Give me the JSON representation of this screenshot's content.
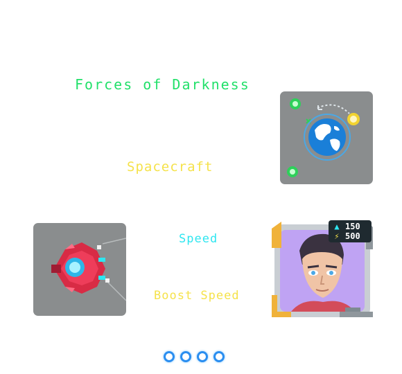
{
  "title": "Forces of Darkness",
  "subtitle": "Spacecraft",
  "stats_labels": {
    "speed": "Speed",
    "boost": "Boost Speed"
  },
  "pilot_stats": {
    "stat1_value": "150",
    "stat2_value": "500"
  },
  "icons": {
    "planet": "planet-orbit-icon",
    "ship": "spaceship-icon",
    "pilot": "pilot-portrait",
    "stat1": "level-up-icon",
    "stat2": "lightning-icon"
  },
  "pager": {
    "count": 4
  },
  "colors": {
    "title": "#22e06a",
    "subtitle": "#f5e24a",
    "speed": "#2ee6f0",
    "boost": "#f5e24a",
    "panel": "#8a8d8e",
    "pager": "#2a8ef0"
  }
}
